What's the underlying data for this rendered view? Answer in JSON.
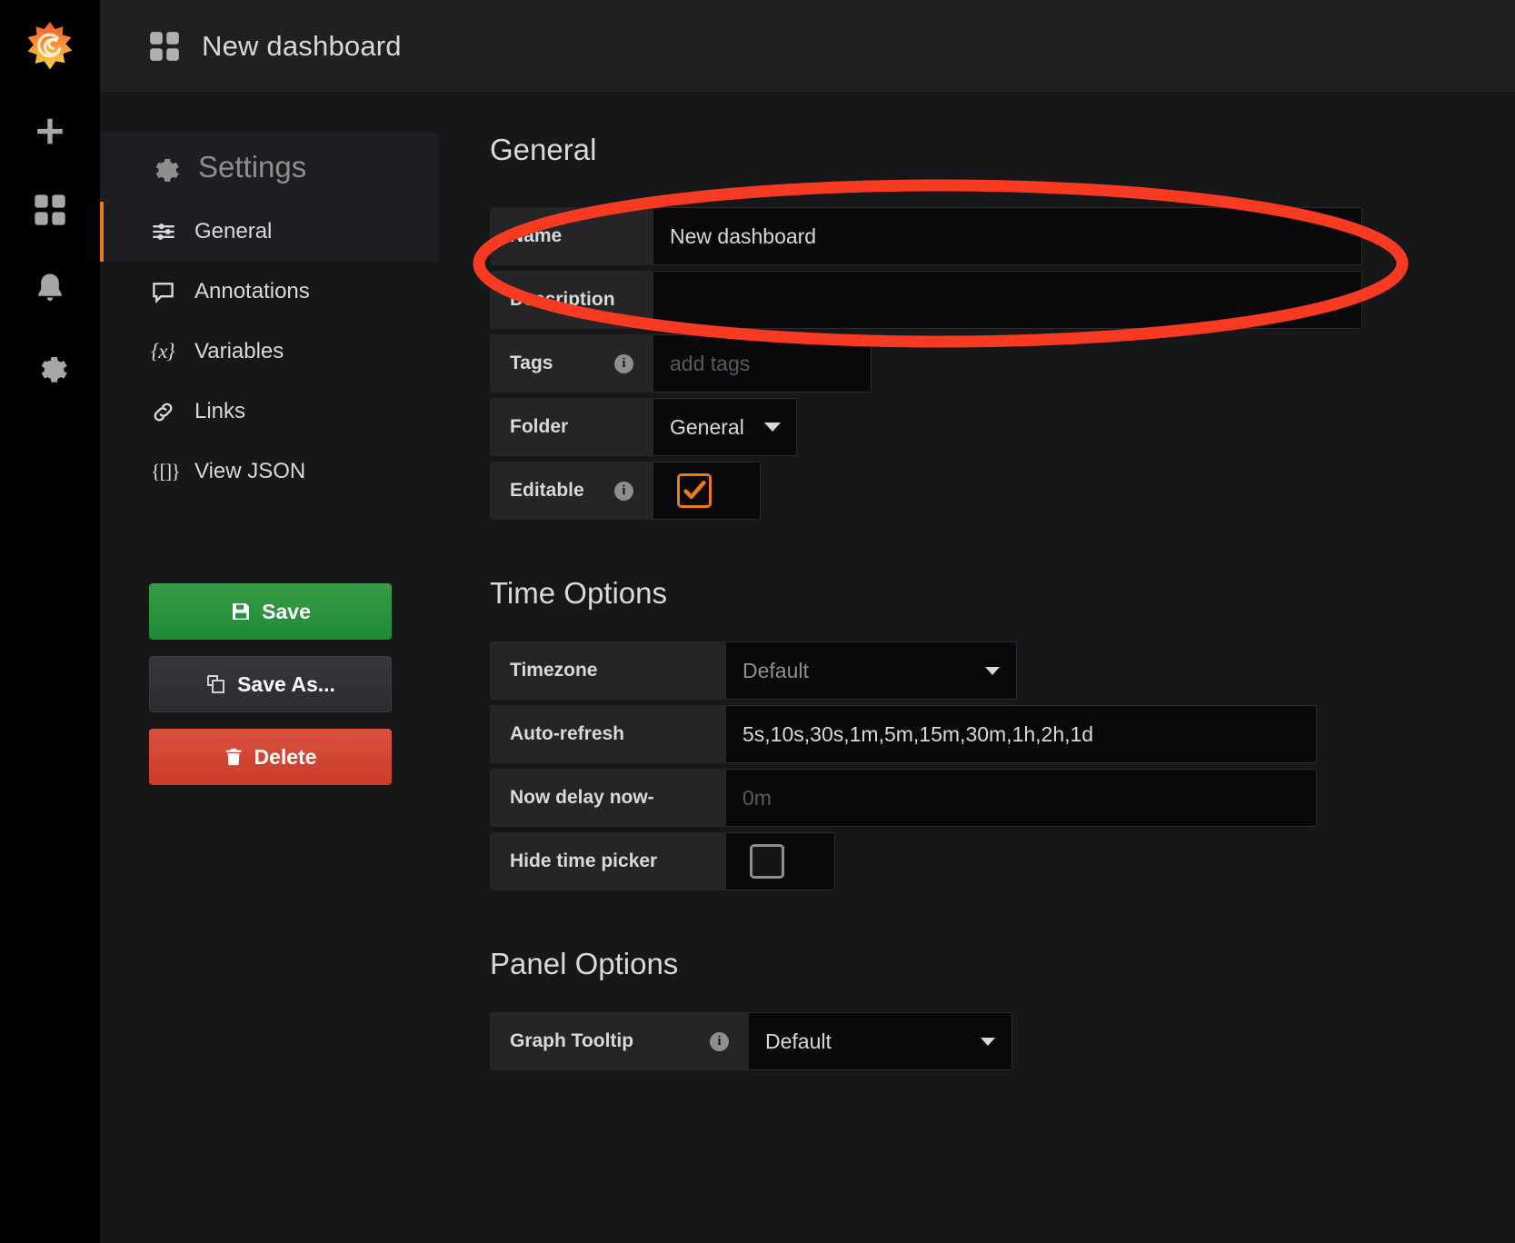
{
  "navrail": {
    "logo_icon": "grafana-logo-icon",
    "items": [
      {
        "icon": "plus-icon",
        "name": "create"
      },
      {
        "icon": "dashboards-grid-icon",
        "name": "dashboards"
      },
      {
        "icon": "bell-icon",
        "name": "alerting"
      },
      {
        "icon": "gear-icon",
        "name": "configuration"
      }
    ]
  },
  "topbar": {
    "icon": "dashboard-grid-icon",
    "title": "New dashboard"
  },
  "settings": {
    "icon": "gear-icon",
    "heading": "Settings",
    "items": [
      {
        "label": "General",
        "icon": "sliders-icon",
        "active": true
      },
      {
        "label": "Annotations",
        "icon": "comment-icon",
        "active": false
      },
      {
        "label": "Variables",
        "icon": "braces-x-icon",
        "active": false
      },
      {
        "label": "Links",
        "icon": "link-icon",
        "active": false
      },
      {
        "label": "View JSON",
        "icon": "braces-brackets-icon",
        "active": false
      }
    ],
    "buttons": {
      "save": "Save",
      "save_as": "Save As...",
      "delete": "Delete"
    }
  },
  "general": {
    "heading": "General",
    "name_label": "Name",
    "name_value": "New dashboard",
    "description_label": "Description",
    "description_value": "",
    "tags_label": "Tags",
    "tags_placeholder": "add tags",
    "folder_label": "Folder",
    "folder_value": "General",
    "editable_label": "Editable",
    "editable_checked": true
  },
  "time_options": {
    "heading": "Time Options",
    "timezone_label": "Timezone",
    "timezone_value": "Default",
    "auto_refresh_label": "Auto-refresh",
    "auto_refresh_value": "5s,10s,30s,1m,5m,15m,30m,1h,2h,1d",
    "now_delay_label": "Now delay now-",
    "now_delay_placeholder": "0m",
    "hide_time_picker_label": "Hide time picker",
    "hide_time_picker_checked": false
  },
  "panel_options": {
    "heading": "Panel Options",
    "graph_tooltip_label": "Graph Tooltip",
    "graph_tooltip_value": "Default"
  },
  "annotation": {
    "shape": "ellipse-highlight",
    "color": "#f93a22",
    "target": "name-field-row"
  },
  "colors": {
    "accent_orange": "#eb7b18",
    "save_green": "#1d8a36",
    "delete_red": "#cc3a28",
    "annotation_red": "#f93a22",
    "panel_bg": "#161719",
    "label_bg": "#252528",
    "input_bg": "#09090b"
  }
}
